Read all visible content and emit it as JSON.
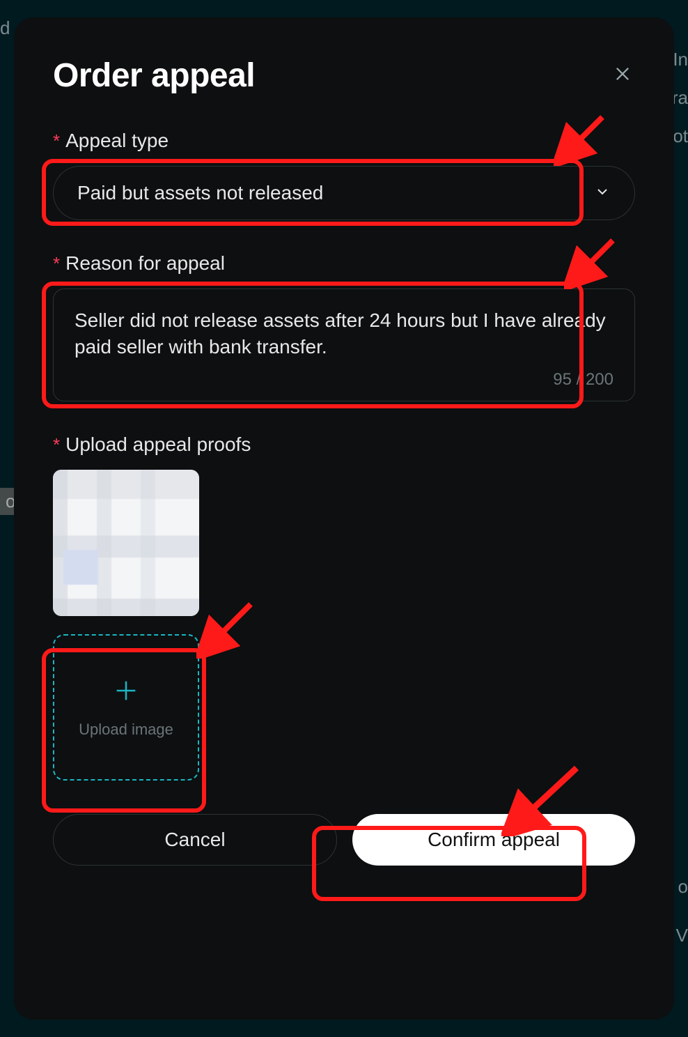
{
  "modal": {
    "title": "Order appeal",
    "close_icon": "close",
    "fields": {
      "appeal_type": {
        "label": "Appeal type",
        "required": true,
        "selected": "Paid but assets not released"
      },
      "reason": {
        "label": "Reason for appeal",
        "required": true,
        "value": "Seller did not release assets after 24 hours but I have already paid seller with bank transfer.",
        "char_count": "95 / 200"
      },
      "proofs": {
        "label": "Upload appeal proofs",
        "required": true,
        "upload_button_label": "Upload image"
      }
    },
    "buttons": {
      "cancel": "Cancel",
      "confirm": "Confirm appeal"
    }
  },
  "annotations": {
    "highlight_color": "#ff1a1a",
    "highlighted_elements": [
      "appeal-type-select",
      "reason-textarea",
      "upload-image-button",
      "confirm-appeal-button"
    ]
  },
  "background_fragments": [
    "d",
    "In",
    "ra",
    "ot",
    "oa",
    "o",
    "V"
  ]
}
